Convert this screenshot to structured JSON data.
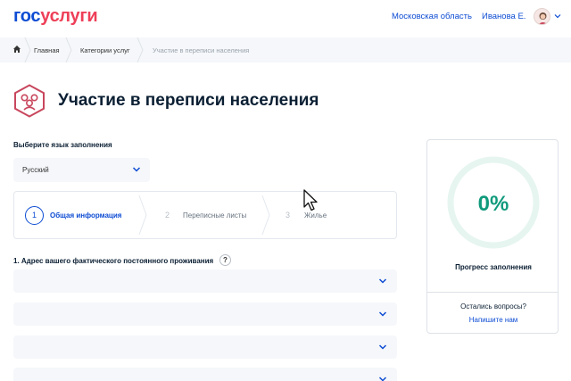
{
  "header": {
    "logo_part1": "гос",
    "logo_part2": "услуги",
    "region": "Московская область",
    "user_name": "Иванова Е."
  },
  "breadcrumb": {
    "items": [
      "Главная",
      "Категории услуг",
      "Участие в переписи населения"
    ]
  },
  "page": {
    "title": "Участие в переписи населения"
  },
  "language": {
    "label": "Выберите язык заполнения",
    "selected": "Русский"
  },
  "steps": [
    {
      "number": "1",
      "label": "Общая информация",
      "active": true
    },
    {
      "number": "2",
      "label": "Переписные листы",
      "active": false
    },
    {
      "number": "3",
      "label": "Жилье",
      "active": false
    }
  ],
  "question": {
    "label": "1. Адрес вашего фактического постоянного проживания",
    "help": "?"
  },
  "progress": {
    "value": 0,
    "percent_text": "0%",
    "label": "Прогресс заполнения",
    "questions_text": "Остались вопросы?",
    "contact_link": "Напишите нам"
  },
  "colors": {
    "brand_blue": "#0d4cd3",
    "brand_red": "#ee3f58",
    "progress_green": "#109a7c",
    "ring_track": "#e6f5f0"
  },
  "icons": [
    "home-icon",
    "census-people-icon",
    "chevron-down-icon",
    "question-icon",
    "cursor-icon",
    "avatar-icon"
  ]
}
